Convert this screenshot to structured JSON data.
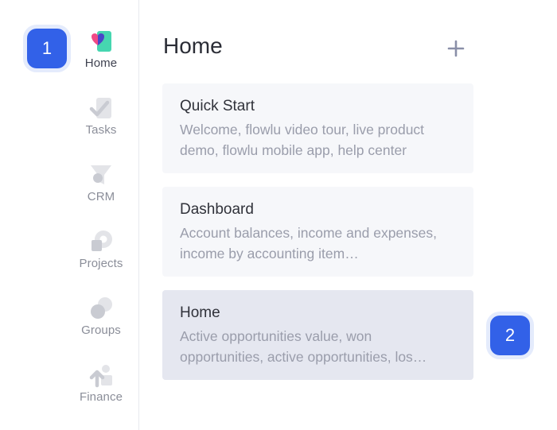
{
  "sidebar": {
    "items": [
      {
        "label": "Home",
        "icon": "home-icon",
        "active": true
      },
      {
        "label": "Tasks",
        "icon": "tasks-icon",
        "active": false
      },
      {
        "label": "CRM",
        "icon": "crm-icon",
        "active": false
      },
      {
        "label": "Projects",
        "icon": "projects-icon",
        "active": false
      },
      {
        "label": "Groups",
        "icon": "groups-icon",
        "active": false
      },
      {
        "label": "Finance",
        "icon": "finance-icon",
        "active": false
      }
    ]
  },
  "badges": {
    "first": "1",
    "second": "2"
  },
  "main": {
    "title": "Home",
    "cards": [
      {
        "title": "Quick Start",
        "description": "Welcome, flowlu video tour, live product demo, flowlu mobile app, help center",
        "selected": false
      },
      {
        "title": "Dashboard",
        "description": "Account balances, income and expenses, income by accounting item…",
        "selected": false
      },
      {
        "title": "Home",
        "description": "Active opportunities value, won opportunities, active opportunities, los…",
        "selected": true
      }
    ]
  },
  "colors": {
    "accent": "#3261e8",
    "card_bg": "#f6f7fa",
    "card_selected_bg": "#e5e7f0",
    "muted_text": "#9a9dab"
  }
}
